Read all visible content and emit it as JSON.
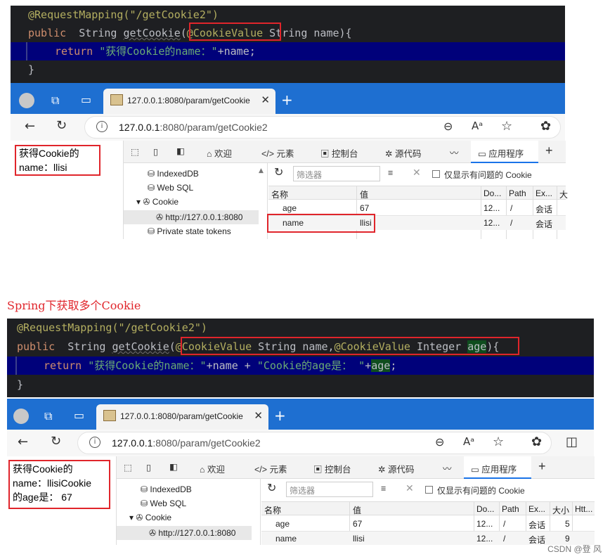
{
  "block1": {
    "code": {
      "annotation": "@RequestMapping(\"/getCookie2\")",
      "kw_public": "public",
      "type_string": "String",
      "method": "getCookie",
      "paren_open": "(",
      "cookie_value": "@CookieValue",
      "params_rest": " String name){",
      "kw_return": "return",
      "str_literal": "\"获得Cookie的name：\"",
      "concat": "+name;",
      "close_brace": "}"
    },
    "tab_title": "127.0.0.1:8080/param/getCookie",
    "tab_close": "✕",
    "new_tab": "+",
    "url_host": "127.0.0.1",
    "url_rest": ":8080/param/getCookie2",
    "page_text_line1": "获得Cookie的",
    "page_text_line2": "name：llisi",
    "rows": [
      {
        "name": "age",
        "value": "67",
        "domain": "12...",
        "path": "/",
        "expires": "会话"
      },
      {
        "name": "name",
        "value": "llisi",
        "domain": "12...",
        "path": "/",
        "expires": "会话"
      }
    ]
  },
  "heading": "Spring下获取多个Cookie",
  "block2": {
    "code": {
      "annotation": "@RequestMapping(\"/getCookie2\")",
      "kw_public": "public",
      "type_string": "String",
      "method": "getCookie",
      "paren_open": "(",
      "cookie_value_1": "@CookieValue",
      "param1": " String name,",
      "cookie_value_2": "@CookieValue",
      "param2_type": " Integer ",
      "param2_name": "age",
      "paren_close": ")",
      "brace_open": "{",
      "kw_return": "return",
      "str1": "\"获得Cookie的name：\"",
      "mid": "+name + ",
      "str2": "\"Cookie的age是： \"",
      "plus": "+",
      "age_var": "age",
      "semicolon": ";",
      "close_brace": "}"
    },
    "tab_title": "127.0.0.1:8080/param/getCookie",
    "tab_close": "✕",
    "new_tab": "+",
    "url_host": "127.0.0.1",
    "url_rest": ":8080/param/getCookie2",
    "page_text_line1": "获得Cookie的",
    "page_text_line2": "name：llisiCookie",
    "page_text_line3": "的age是： 67",
    "rows": [
      {
        "name": "age",
        "value": "67",
        "domain": "12...",
        "path": "/",
        "expires": "会话",
        "size": "5"
      },
      {
        "name": "name",
        "value": "llisi",
        "domain": "12...",
        "path": "/",
        "expires": "会话",
        "size": "9"
      }
    ]
  },
  "devtools": {
    "tab_welcome": "欢迎",
    "tab_elements": "元素",
    "tab_console": "控制台",
    "tab_sources": "源代码",
    "tab_application": "应用程序",
    "add_tab": "+",
    "tree_indexeddb": "IndexedDB",
    "tree_websql": "Web SQL",
    "tree_cookie": "Cookie",
    "tree_cookie_url": "http://127.0.0.1:8080",
    "tree_private": "Private state tokens",
    "filter_placeholder": "筛选器",
    "show_issues_label": "仅显示有问题的 Cookie",
    "col_name": "名称",
    "col_value": "值",
    "col_domain": "Do...",
    "col_path": "Path",
    "col_expires": "Ex...",
    "col_size_short": "大",
    "col_size": "大小",
    "col_http": "Htt..."
  },
  "watermark": "CSDN @登 风",
  "colors": {
    "code_bg": "#1e1f22",
    "highlight_line": "#00017a",
    "annotation": "#b3ae60",
    "keyword": "#cf8e6d",
    "string": "#6aab73",
    "red_box": "#e0252b",
    "tab_bar": "#1e6fd1"
  }
}
